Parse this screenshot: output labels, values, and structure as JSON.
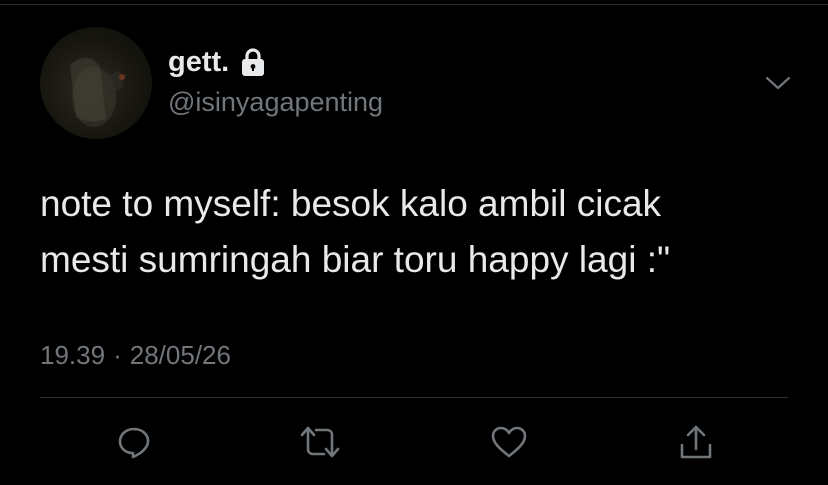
{
  "tweet": {
    "author": {
      "display_name": "gett.",
      "handle": "@isinyagapenting",
      "verified_lock_icon": "lock-icon",
      "avatar_icon": "avatar"
    },
    "text_lines": [
      "note to myself: besok kalo ambil cicak",
      "mesti sumringah biar toru happy lagi :\""
    ],
    "time": "19.39",
    "separator": "·",
    "date": "28/05/26"
  },
  "actions": [
    {
      "name": "reply",
      "icon": "reply-icon"
    },
    {
      "name": "retweet",
      "icon": "retweet-icon"
    },
    {
      "name": "like",
      "icon": "heart-icon"
    },
    {
      "name": "share",
      "icon": "share-icon"
    }
  ],
  "menu": {
    "icon": "chevron-down-icon"
  },
  "colors": {
    "background": "#000000",
    "text": "#e7e9ea",
    "muted": "#71767b",
    "divider": "#2f3336"
  }
}
